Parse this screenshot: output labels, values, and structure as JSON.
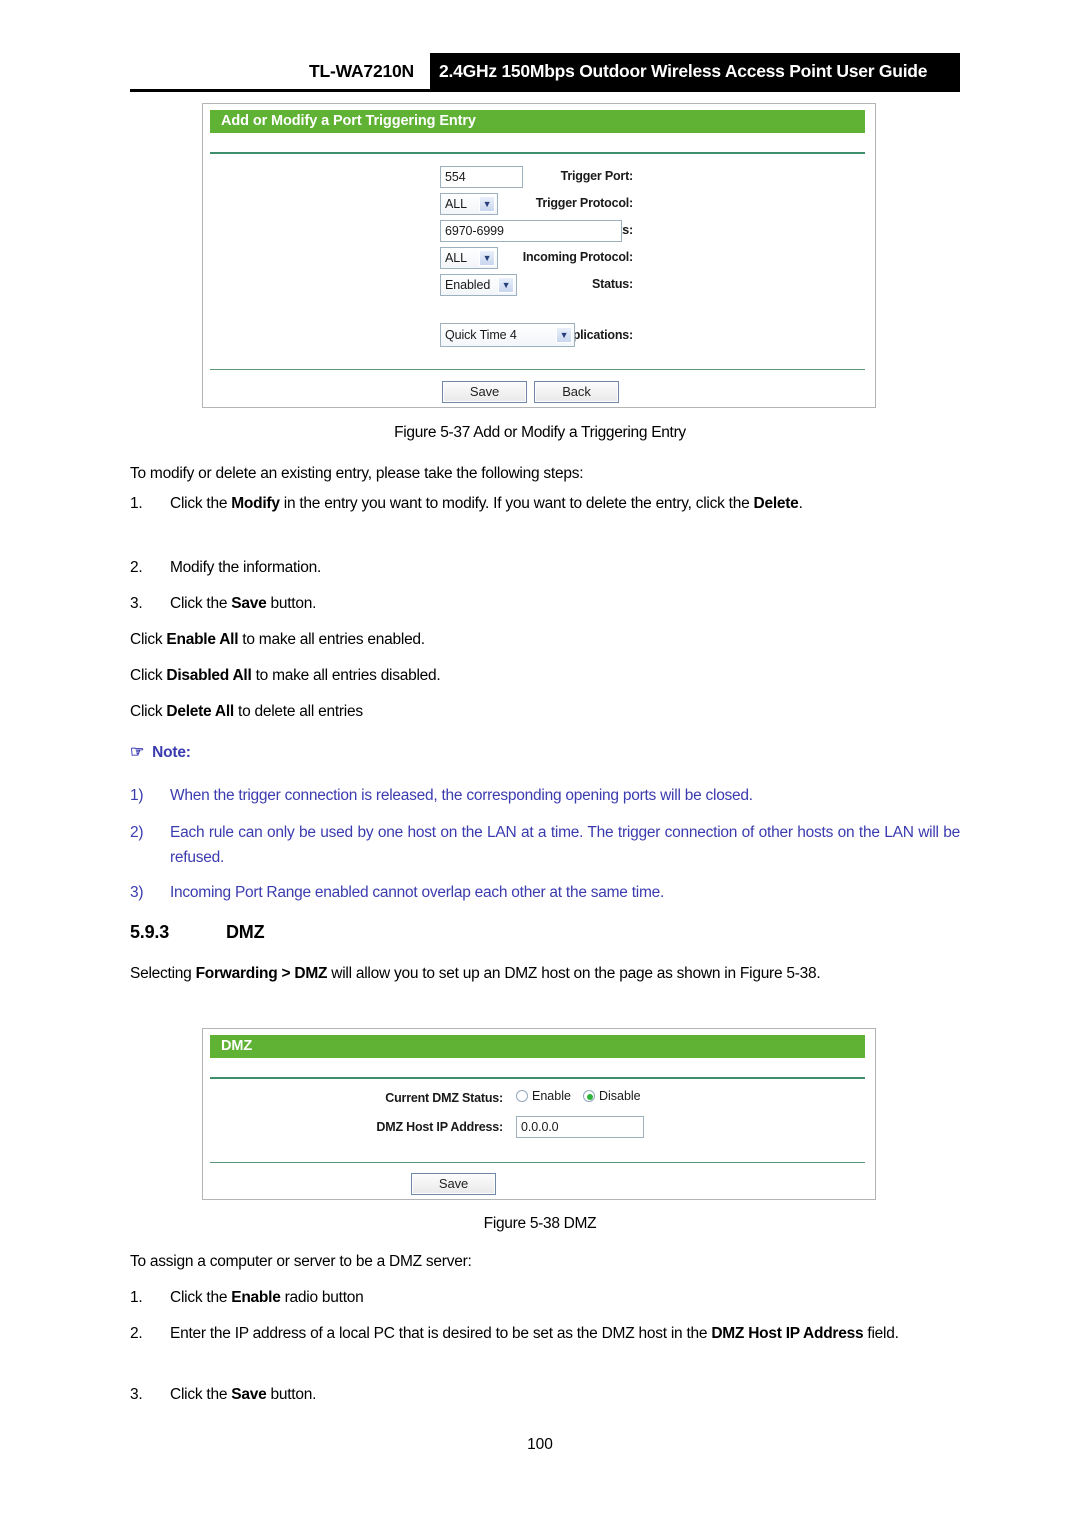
{
  "header": {
    "model": "TL-WA7210N",
    "title": "2.4GHz 150Mbps Outdoor Wireless Access Point User Guide"
  },
  "colors": {
    "panel_green": "#5fb234",
    "panel_rule": "#3f8f6e",
    "note_blue": "#3b3bb0",
    "radio_on": "#2bb33a"
  },
  "trigger_panel": {
    "heading": "Add or Modify a Port Triggering Entry",
    "fields": [
      {
        "label": "Trigger Port:",
        "value": "554",
        "kind": "text"
      },
      {
        "label": "Trigger Protocol:",
        "value": "ALL",
        "kind": "select"
      },
      {
        "label": "Incoming Ports:",
        "value": "6970-6999",
        "kind": "text"
      },
      {
        "label": "Incoming Protocol:",
        "value": "ALL",
        "kind": "select"
      },
      {
        "label": "Status:",
        "value": "Enabled",
        "kind": "select"
      },
      {
        "label": "Common Applications:",
        "value": "Quick Time 4",
        "kind": "select"
      }
    ],
    "buttons": {
      "save": "Save",
      "back": "Back"
    }
  },
  "figure_537": "Figure 5-37 Add or Modify a Triggering Entry",
  "body_intro": "To modify or delete an existing entry, please take the following steps:",
  "steps_modify": [
    {
      "num": "1.",
      "html": "Click the <b>Modify</b> in the entry you want to modify. If you want to delete the entry, click the <b>Delete</b>."
    },
    {
      "num": "2.",
      "html": "Modify the information."
    },
    {
      "num": "3.",
      "html": "Click the <b>Save</b> button."
    }
  ],
  "click_lines": [
    "Click <b>Enable All</b> to make all entries enabled.",
    "Click <b>Disabled All</b> to make all entries disabled.",
    "Click <b>Delete All</b> to delete all entries"
  ],
  "note": {
    "icon": "hand-pointing-right-icon",
    "glyph": "☞",
    "label": "Note:",
    "items": [
      {
        "num": "1)",
        "text": "When the trigger connection is released, the corresponding opening ports will be closed."
      },
      {
        "num": "2)",
        "text": "Each rule can only be used by one host on the LAN at a time. The trigger connection of other hosts on the LAN will be refused."
      },
      {
        "num": "3)",
        "text": "Incoming Port Range enabled cannot overlap each other at the same time."
      }
    ]
  },
  "section": {
    "number": "5.9.3",
    "title": "DMZ",
    "intro_html": "Selecting <b>Forwarding &gt; DMZ</b> will allow you to set up an DMZ host on the page as shown in Figure 5-38."
  },
  "dmz_panel": {
    "heading": "DMZ",
    "status_label": "Current DMZ Status:",
    "radios": [
      {
        "label": "Enable",
        "selected": false
      },
      {
        "label": "Disable",
        "selected": true
      }
    ],
    "ip_label": "DMZ Host IP Address:",
    "ip_value": "0.0.0.0",
    "buttons": {
      "save": "Save"
    }
  },
  "figure_538": "Figure 5-38 DMZ",
  "dmz_intro": "To assign a computer or server to be a DMZ server:",
  "steps_dmz": [
    {
      "num": "1.",
      "html": "Click the <b>Enable</b> radio button"
    },
    {
      "num": "2.",
      "html": "Enter the IP address of a local PC that is desired to be set as the DMZ host in the <b>DMZ Host IP Address</b> field."
    },
    {
      "num": "3.",
      "html": "Click the <b>Save</b> button."
    }
  ],
  "page_number": "100"
}
